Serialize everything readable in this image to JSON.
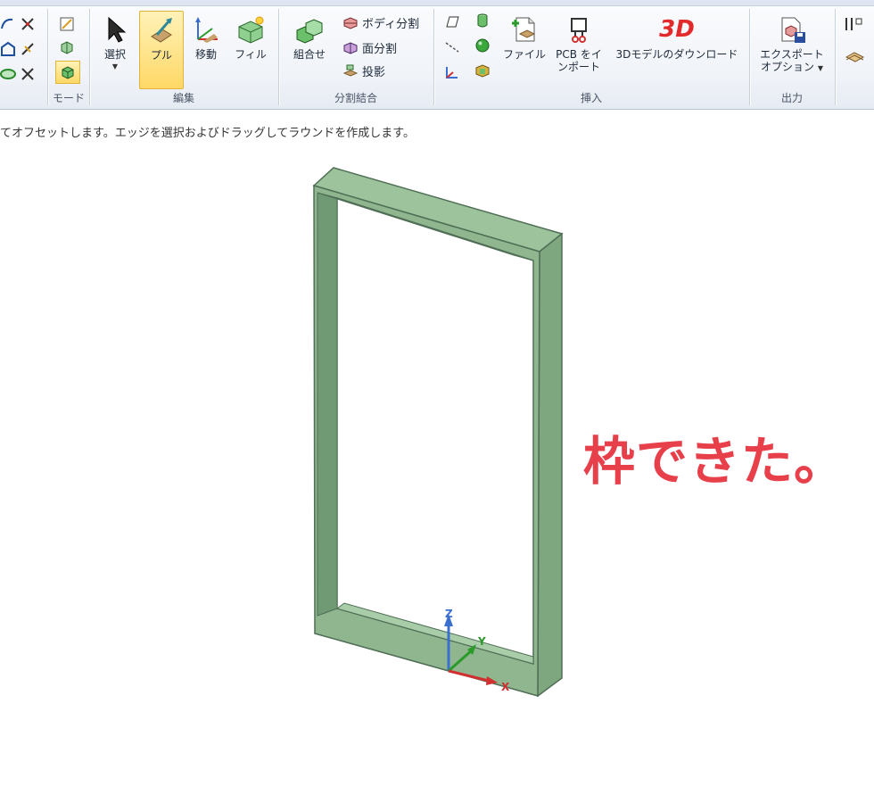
{
  "ribbon": {
    "mode": {
      "label": "モード"
    },
    "edit": {
      "label": "編集",
      "select": "選択",
      "pull": "プル",
      "move": "移動",
      "fill": "フィル"
    },
    "split_combine": {
      "label": "分割結合",
      "combine": "組合せ",
      "split_body": "ボディ分割",
      "split_face": "面分割",
      "project": "投影"
    },
    "insert": {
      "label": "挿入",
      "file": "ファイル",
      "pcb_import_line1": "PCB をイ",
      "pcb_import_line2": "ンポート",
      "download_3d_logo": "3D",
      "download_3d": "3Dモデルのダウンロード"
    },
    "output": {
      "label": "出力",
      "export_line1": "エクスポート",
      "export_line2": "オプション"
    }
  },
  "status_text": "てオフセットします。エッジを選択およびドラッグしてラウンドを作成します。",
  "viewport": {
    "caption": "枠できた。",
    "axes": {
      "z": "Z",
      "y": "Y",
      "x": "X"
    }
  },
  "colors": {
    "frame_front": "#8fb68f",
    "frame_inner": "#6f9a74",
    "frame_edge": "#4f6e55",
    "caption": "#e8404a",
    "active_button": "#ffd867"
  }
}
